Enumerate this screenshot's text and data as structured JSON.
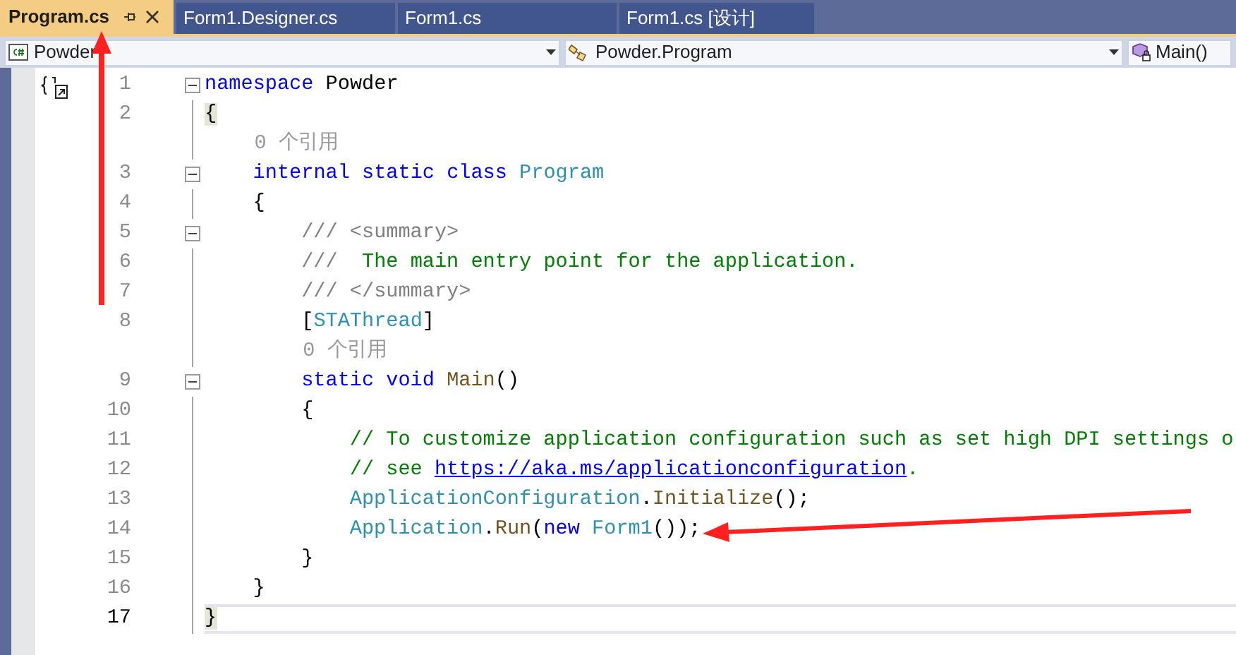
{
  "tabs": [
    {
      "label": "Program.cs",
      "selected": true
    },
    {
      "label": "Form1.Designer.cs",
      "selected": false
    },
    {
      "label": "Form1.cs",
      "selected": false
    },
    {
      "label": "Form1.cs [设计]",
      "selected": false
    }
  ],
  "navigation_bar": {
    "project": "Powder",
    "type": "Powder.Program",
    "member": "Main()"
  },
  "editor": {
    "lines": [
      {
        "kind": "code",
        "number": "1",
        "fold_toggle": true,
        "current": false,
        "tokens": [
          {
            "kind": "keyword",
            "text": "namespace"
          },
          {
            "kind": "plain",
            "text": " Powder"
          }
        ]
      },
      {
        "kind": "code",
        "number": "2",
        "fold_toggle": false,
        "current": false,
        "tokens": [
          {
            "kind": "brace",
            "text": "{"
          }
        ],
        "children": [
          {
            "kind": "codelens",
            "text": "0 个引用"
          },
          {
            "kind": "code",
            "number": "3",
            "fold_toggle": true,
            "current": false,
            "tokens": [
              {
                "kind": "keyword",
                "text": "internal static class "
              },
              {
                "kind": "type",
                "text": "Program"
              }
            ]
          },
          {
            "kind": "code",
            "number": "4",
            "fold_toggle": false,
            "current": false,
            "tokens": [
              {
                "kind": "plain",
                "text": "{"
              }
            ],
            "children": [
              {
                "kind": "code",
                "number": "5",
                "fold_toggle": true,
                "current": false,
                "tokens": [
                  {
                    "kind": "doc",
                    "text": "/// <summary>"
                  }
                ]
              },
              {
                "kind": "code",
                "number": "6",
                "fold_toggle": false,
                "current": false,
                "tokens": [
                  {
                    "kind": "doc",
                    "text": "///  "
                  },
                  {
                    "kind": "comment",
                    "text": "The main entry point for the application."
                  }
                ]
              },
              {
                "kind": "code",
                "number": "7",
                "fold_toggle": false,
                "current": false,
                "tokens": [
                  {
                    "kind": "doc",
                    "text": "/// </summary>"
                  }
                ]
              },
              {
                "kind": "code",
                "number": "8",
                "fold_toggle": false,
                "current": false,
                "tokens": [
                  {
                    "kind": "plain",
                    "text": "["
                  },
                  {
                    "kind": "type",
                    "text": "STAThread"
                  },
                  {
                    "kind": "plain",
                    "text": "]"
                  }
                ]
              },
              {
                "kind": "codelens",
                "text": "0 个引用"
              },
              {
                "kind": "code",
                "number": "9",
                "fold_toggle": true,
                "current": false,
                "tokens": [
                  {
                    "kind": "keyword",
                    "text": "static void "
                  },
                  {
                    "kind": "method",
                    "text": "Main"
                  },
                  {
                    "kind": "plain",
                    "text": "()"
                  }
                ]
              },
              {
                "kind": "code",
                "number": "10",
                "fold_toggle": false,
                "current": false,
                "tokens": [
                  {
                    "kind": "plain",
                    "text": "{"
                  }
                ],
                "children": [
                  {
                    "kind": "code",
                    "number": "11",
                    "fold_toggle": false,
                    "current": false,
                    "tokens": [
                      {
                        "kind": "comment",
                        "text": "// To customize application configuration such as set high DPI settings o"
                      }
                    ]
                  },
                  {
                    "kind": "code",
                    "number": "12",
                    "fold_toggle": false,
                    "current": false,
                    "tokens": [
                      {
                        "kind": "comment",
                        "text": "// see "
                      },
                      {
                        "kind": "link",
                        "text": "https://aka.ms/applicationconfiguration"
                      },
                      {
                        "kind": "comment",
                        "text": "."
                      }
                    ]
                  },
                  {
                    "kind": "code",
                    "number": "13",
                    "fold_toggle": false,
                    "current": false,
                    "tokens": [
                      {
                        "kind": "type",
                        "text": "ApplicationConfiguration"
                      },
                      {
                        "kind": "plain",
                        "text": "."
                      },
                      {
                        "kind": "method",
                        "text": "Initialize"
                      },
                      {
                        "kind": "plain",
                        "text": "();"
                      }
                    ]
                  },
                  {
                    "kind": "code",
                    "number": "14",
                    "fold_toggle": false,
                    "current": false,
                    "tokens": [
                      {
                        "kind": "type",
                        "text": "Application"
                      },
                      {
                        "kind": "plain",
                        "text": "."
                      },
                      {
                        "kind": "method",
                        "text": "Run"
                      },
                      {
                        "kind": "plain",
                        "text": "("
                      },
                      {
                        "kind": "keyword",
                        "text": "new "
                      },
                      {
                        "kind": "type",
                        "text": "Form1"
                      },
                      {
                        "kind": "plain",
                        "text": "());"
                      }
                    ]
                  }
                ]
              },
              {
                "kind": "code",
                "number": "15",
                "fold_toggle": false,
                "current": false,
                "tokens": [
                  {
                    "kind": "plain",
                    "text": "}"
                  }
                ]
              }
            ]
          },
          {
            "kind": "code",
            "number": "16",
            "fold_toggle": false,
            "current": false,
            "tokens": [
              {
                "kind": "plain",
                "text": "}"
              }
            ]
          }
        ]
      },
      {
        "kind": "code",
        "number": "17",
        "fold_toggle": false,
        "current": true,
        "tokens": [
          {
            "kind": "brace",
            "text": "}"
          }
        ]
      }
    ]
  }
}
